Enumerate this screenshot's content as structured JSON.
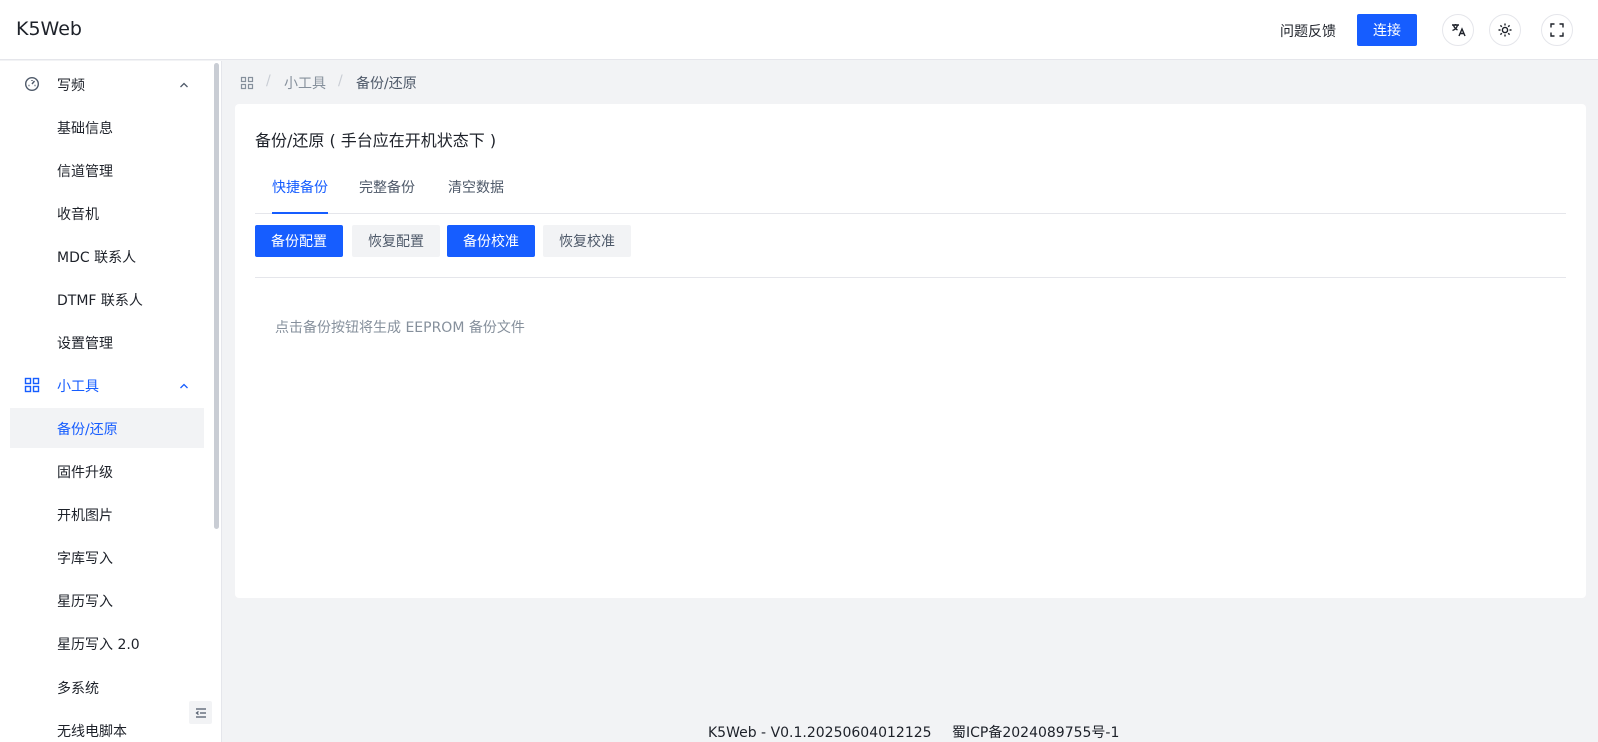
{
  "header": {
    "logo": "K5Web",
    "feedback": "问题反馈",
    "connect": "连接",
    "icons": [
      "translate-icon",
      "theme-icon",
      "fullscreen-icon"
    ]
  },
  "sidebar": {
    "group1": {
      "label": "写频",
      "icon": "dashboard-icon"
    },
    "group1_items": [
      "基础信息",
      "信道管理",
      "收音机",
      "MDC 联系人",
      "DTMF 联系人",
      "设置管理"
    ],
    "group2": {
      "label": "小工具",
      "icon": "apps-icon"
    },
    "group2_items": [
      "备份/还原",
      "固件升级",
      "开机图片",
      "字库写入",
      "星历写入",
      "星历写入 2.0",
      "多系统",
      "无线电脚本"
    ],
    "active_item": "备份/还原"
  },
  "breadcrumb": {
    "items": [
      "小工具",
      "备份/还原"
    ]
  },
  "card": {
    "title": "备份/还原 ( 手台应在开机状态下 )",
    "tabs": [
      "快捷备份",
      "完整备份",
      "清空数据"
    ],
    "buttons": [
      "备份配置",
      "恢复配置",
      "备份校准",
      "恢复校准"
    ],
    "hint": "点击备份按钮将生成 EEPROM 备份文件"
  },
  "footer": {
    "version": "K5Web - V0.1.20250604012125",
    "icp": "蜀ICP备2024089755号-1"
  },
  "colors": {
    "primary": "#165dff",
    "bg": "#f2f3f5",
    "text": "#1d2129",
    "muted": "#86909c"
  }
}
